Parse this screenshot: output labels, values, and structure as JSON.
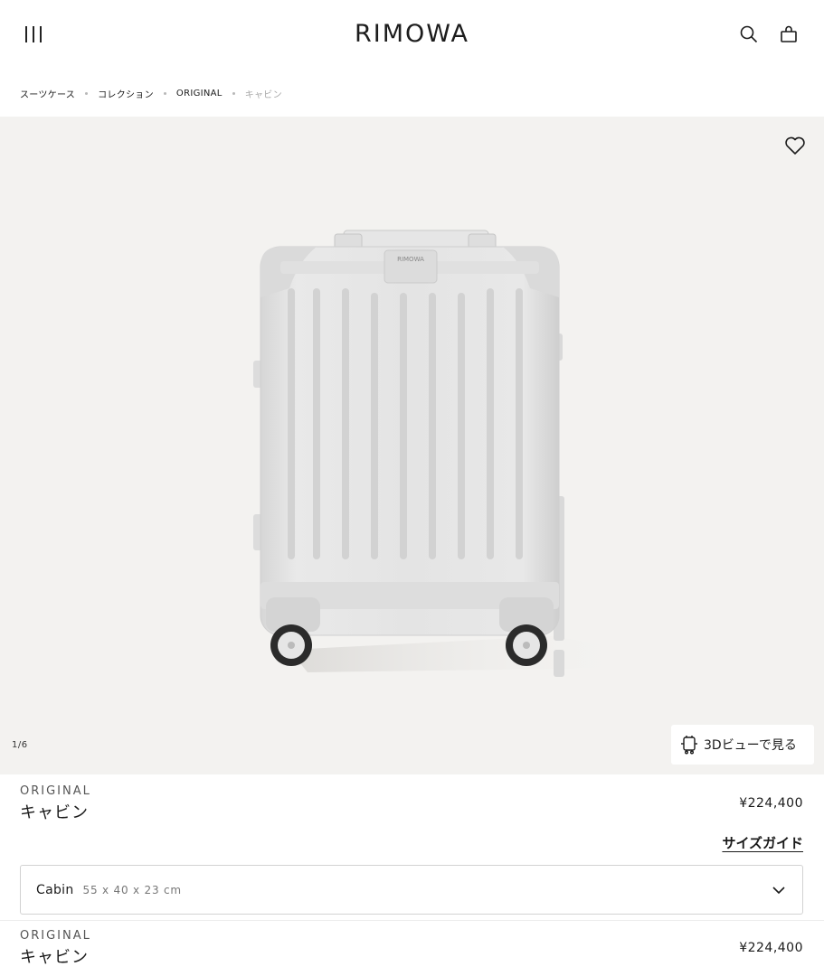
{
  "header": {
    "logo": "RIMOWA",
    "menu_icon": "menu-icon",
    "search_icon": "search-icon",
    "bag_icon": "shopping-bag-icon"
  },
  "breadcrumb": [
    {
      "label": "スーツケース"
    },
    {
      "label": "コレクション"
    },
    {
      "label": "ORIGINAL"
    },
    {
      "label": "キャビン"
    }
  ],
  "gallery": {
    "counter": "1/6",
    "view_3d_label": "3Dビューで見る",
    "favorite_icon": "heart-icon",
    "suitcase_logo": "RIMOWA",
    "background_color": "#f3f2f0"
  },
  "product": {
    "collection": "ORIGINAL",
    "name": "キャビン",
    "price": "¥224,400"
  },
  "size_guide_label": "サイズガイド",
  "size_select": {
    "name": "Cabin",
    "dimensions": "55 x 40 x 23 cm"
  },
  "sticky_product": {
    "collection": "ORIGINAL",
    "name": "キャビン",
    "price": "¥224,400"
  }
}
